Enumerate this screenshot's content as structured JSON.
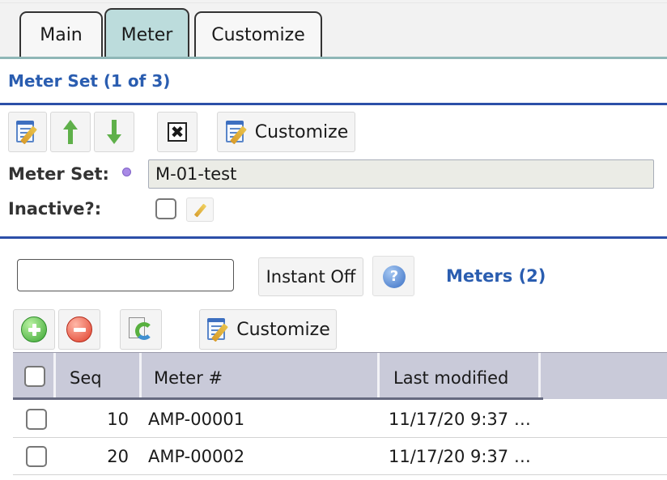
{
  "tabs": [
    {
      "label": "Main",
      "active": false
    },
    {
      "label": "Meter",
      "active": true
    },
    {
      "label": "Customize",
      "active": false
    }
  ],
  "meter_set_section": {
    "title": "Meter Set (1 of 3)",
    "toolbar": {
      "customize_label": "Customize",
      "delete_glyph": "✖"
    },
    "fields": {
      "meter_set_label": "Meter Set:",
      "meter_set_value": "M-01-test",
      "inactive_label": "Inactive?:",
      "inactive_checked": false
    }
  },
  "meters_section": {
    "search_value": "",
    "instant_off_label": "Instant Off",
    "help_glyph": "?",
    "title": "Meters (2)",
    "toolbar": {
      "customize_label": "Customize"
    },
    "table": {
      "columns": [
        "Seq",
        "Meter #",
        "Last modified"
      ],
      "rows": [
        {
          "seq": "10",
          "meter": "AMP-00001",
          "last_modified": "11/17/20 9:37 …",
          "checked": false
        },
        {
          "seq": "20",
          "meter": "AMP-00002",
          "last_modified": "11/17/20 9:37 …",
          "checked": false
        }
      ]
    }
  },
  "colors": {
    "accent_blue": "#2a5db0",
    "active_tab": "#bcdcdc",
    "grid_header": "#c9cad9",
    "required_dot": "#a98ae6"
  },
  "icons": [
    "edit-icon",
    "arrow-up-icon",
    "arrow-down-icon",
    "delete-icon",
    "customize-icon",
    "edit-pencil-icon",
    "help-icon",
    "add-icon",
    "remove-icon",
    "refresh-icon"
  ]
}
